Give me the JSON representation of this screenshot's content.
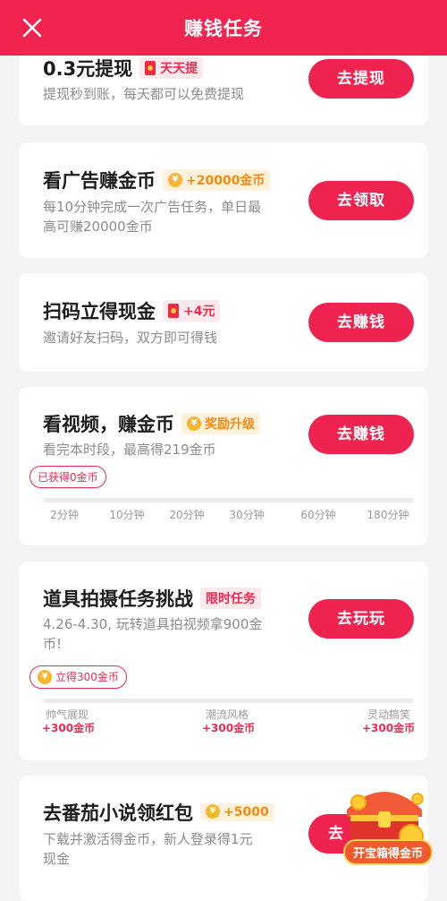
{
  "header": {
    "title": "赚钱任务"
  },
  "tasks": [
    {
      "title": "0.3元提现",
      "tag": "天天提",
      "desc": "提现秒到账，每天都可以免费提现",
      "button": "去提现"
    },
    {
      "title": "看广告赚金币",
      "tag": "+20000金币",
      "desc1": "每10分钟完成一次广告任务，单日最",
      "desc2": "高可赚20000金币",
      "button": "去领取"
    },
    {
      "title": "扫码立得现金",
      "tag": "+4元",
      "desc": "邀请好友扫码，双方即可得钱",
      "button": "去赚钱"
    },
    {
      "title": "看视频，赚金币",
      "tag": "奖励升级",
      "desc": "看完本时段，最高得219金币",
      "button": "去赚钱",
      "badge": "已获得0金币",
      "ticks": [
        "2分钟",
        "10分钟",
        "20分钟",
        "30分钟",
        "60分钟",
        "180分钟"
      ]
    },
    {
      "title": "道具拍摄任务挑战",
      "tag": "限时任务",
      "desc1": "4.26-4.30, 玩转道具拍视频拿900金",
      "desc2": "币!",
      "button": "去玩玩",
      "badge": "立得300金币",
      "milestones": [
        {
          "label": "帅气展现",
          "reward": "+300金币"
        },
        {
          "label": "潮流风格",
          "reward": "+300金币"
        },
        {
          "label": "灵动搞笑",
          "reward": "+300金币"
        }
      ]
    },
    {
      "title": "去番茄小说领红包",
      "tag": "+5000",
      "desc1": "下载并激活得金币，新人登录得1元",
      "desc2": "现金",
      "button": "去",
      "chest_label": "开宝箱得金币"
    }
  ],
  "colors": {
    "accent": "#f0244f",
    "coin": "#f6b52e"
  }
}
